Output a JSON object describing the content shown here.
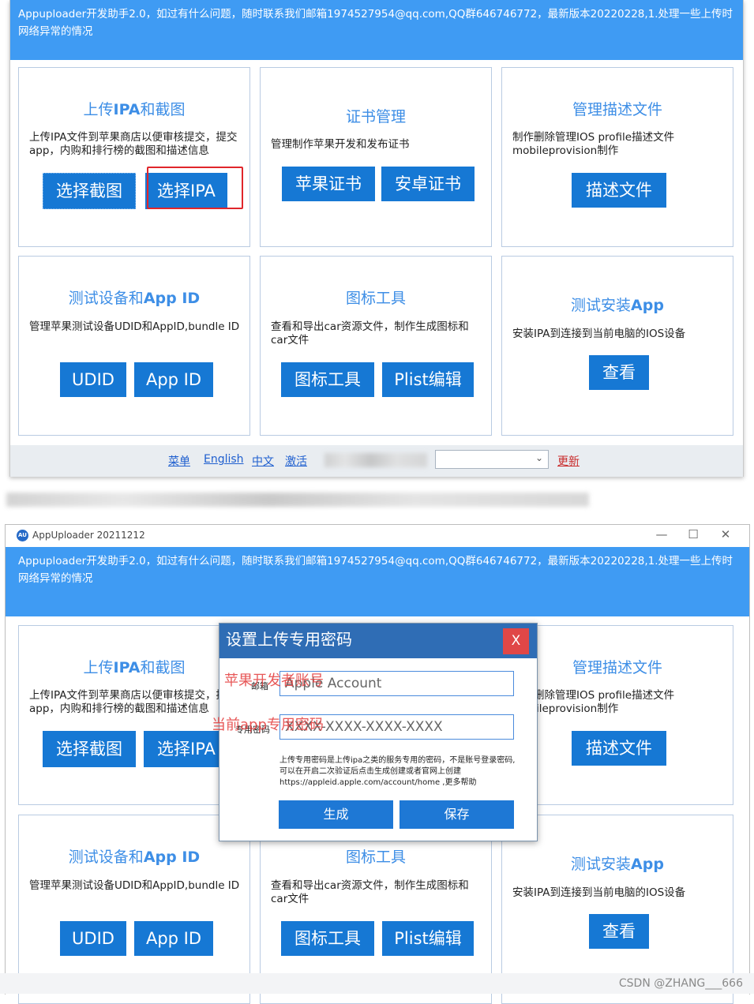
{
  "banner_text": "Appuploader开发助手2.0，如过有什么问题，随时联系我们邮箱1974527954@qq.com,QQ群646746772，最新版本20220228,1.处理一些上传时网络异常的情况",
  "window2": {
    "title": "AppUploader 20211212",
    "logo_text": "AU",
    "controls": {
      "minimize": "—",
      "maximize": "☐",
      "close": "✕"
    }
  },
  "cards": {
    "upload": {
      "title_pre": "上传",
      "title_bold": "IPA",
      "title_post": "和截图",
      "desc": "上传IPA文件到苹果商店以便审核提交，提交app，内购和排行榜的截图和描述信息",
      "btn1": "选择截图",
      "btn2": "选择IPA"
    },
    "cert": {
      "title": "证书管理",
      "desc": "管理制作苹果开发和发布证书",
      "btn1": "苹果证书",
      "btn2": "安卓证书"
    },
    "profile": {
      "title": "管理描述文件",
      "desc": "制作删除管理IOS profile描述文件mobileprovision制作",
      "btn1": "描述文件"
    },
    "device": {
      "title_pre": "测试设备和",
      "title_bold": "App ID",
      "desc": "管理苹果测试设备UDID和AppID,bundle ID",
      "btn1": "UDID",
      "btn2": "App ID"
    },
    "icon": {
      "title": "图标工具",
      "desc": "查看和导出car资源文件，制作生成图标和car文件",
      "btn1": "图标工具",
      "btn2": "Plist编辑"
    },
    "install": {
      "title_pre": "测试安装",
      "title_bold": "App",
      "desc": "安装IPA到连接到当前电脑的IOS设备",
      "btn1": "查看"
    }
  },
  "statusbar": {
    "menu": "菜单",
    "english": "English",
    "chinese": "中文",
    "activate": "激活",
    "refresh": "更新"
  },
  "dialog": {
    "title": "设置上传专用密码",
    "close": "X",
    "email_label": "邮箱",
    "email_placeholder": "Apple Account",
    "password_label": "专用密码",
    "password_placeholder": "XXXX-XXXX-XXXX-XXXX",
    "note": "上传专用密码是上传ipa之类的服务专用的密码，不是账号登录密码,可以在开启二次验证后点击生成创建或者官网上创建https://appleid.apple.com/account/home ,更多帮助",
    "generate": "生成",
    "save": "保存"
  },
  "annotations": {
    "account": "苹果开发者账号",
    "password": "当前app专用密码"
  },
  "watermark": "CSDN @ZHANG___666",
  "colors": {
    "banner": "#3f9bf3",
    "button": "#1678d4",
    "dialog_header": "#2f6db5",
    "highlight": "#e0262b"
  }
}
